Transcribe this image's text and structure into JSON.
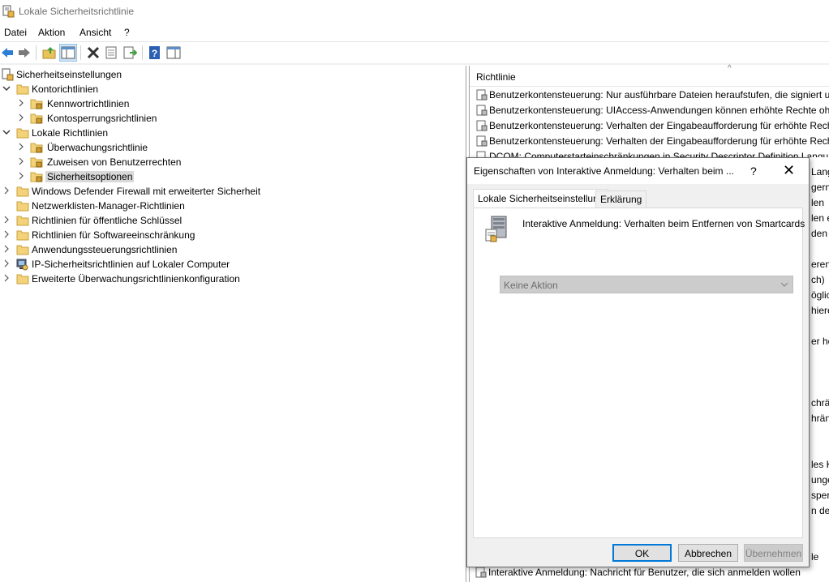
{
  "window": {
    "title": "Lokale Sicherheitsrichtlinie"
  },
  "menu": [
    "Datei",
    "Aktion",
    "Ansicht",
    "?"
  ],
  "toolbar": {
    "buttons": [
      "back-arrow-icon",
      "forward-arrow-icon",
      "up-folder-icon",
      "show-hide-tree-icon",
      "delete-icon",
      "properties-icon",
      "export-list-icon",
      "help-icon",
      "show-hide-action-pane-icon"
    ]
  },
  "tree": {
    "root": "Sicherheitseinstellungen",
    "items": [
      "Kontorichtlinien",
      "Kennwortrichtlinien",
      "Kontosperrungsrichtlinien",
      "Lokale Richtlinien",
      "Überwachungsrichtlinie",
      "Zuweisen von Benutzerrechten",
      "Sicherheitsoptionen",
      "Windows Defender Firewall mit erweiterter Sicherheit",
      "Netzwerklisten-Manager-Richtlinien",
      "Richtlinien für öffentliche Schlüssel",
      "Richtlinien für Softwareeinschränkung",
      "Anwendungssteuerungsrichtlinien",
      "IP-Sicherheitsrichtlinien auf Lokaler Computer",
      "Erweiterte Überwachungsrichtlinienkonfiguration"
    ]
  },
  "list": {
    "header": "Richtlinie",
    "rows": [
      "Benutzerkontensteuerung: Nur ausführbare Dateien heraufstufen, die signiert und",
      "Benutzerkontensteuerung: UIAccess-Anwendungen können erhöhte Rechte ohne",
      "Benutzerkontensteuerung: Verhalten der Eingabeaufforderung für erhöhte Rechte",
      "Benutzerkontensteuerung: Verhalten der Eingabeaufforderung für erhöhte Rechte",
      "DCOM: Computerstarteinschränkungen in Security Descriptor Definition Language"
    ],
    "side_fragments": [
      "Lang",
      "gern",
      "len",
      "len e",
      "den A",
      "eren",
      "ch)",
      "öglic",
      "hieren",
      "er hö",
      "chrä",
      "hrän",
      "les Ko",
      "unge",
      "sperr",
      "n der",
      "le"
    ],
    "bottom_row": "Interaktive Anmeldung: Nachricht für Benutzer, die sich anmelden wollen"
  },
  "dialog": {
    "title": "Eigenschaften von Interaktive Anmeldung: Verhalten beim ...",
    "help": "?",
    "close": "✕",
    "tabs": [
      "Lokale Sicherheitseinstellung",
      "Erklärung"
    ],
    "policy_name": "Interaktive Anmeldung: Verhalten beim Entfernen von Smartcards",
    "dropdown_value": "Keine Aktion",
    "buttons": {
      "ok": "OK",
      "cancel": "Abbrechen",
      "apply": "Übernehmen"
    }
  }
}
